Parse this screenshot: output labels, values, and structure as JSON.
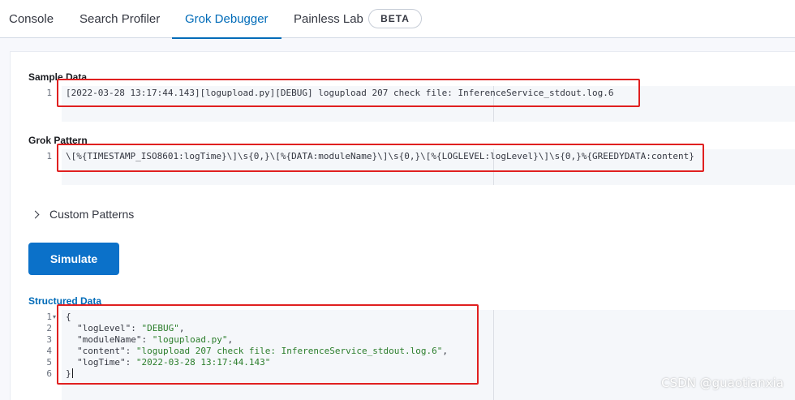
{
  "tabs": [
    {
      "label": "Console",
      "active": false
    },
    {
      "label": "Search Profiler",
      "active": false
    },
    {
      "label": "Grok Debugger",
      "active": true
    },
    {
      "label": "Painless Lab",
      "active": false
    }
  ],
  "badge": "BETA",
  "sample_data": {
    "label": "Sample Data",
    "lines": [
      {
        "num": "1",
        "text": "[2022-03-28 13:17:44.143][logupload.py][DEBUG] logupload 207 check file: InferenceService_stdout.log.6"
      }
    ]
  },
  "grok_pattern": {
    "label": "Grok Pattern",
    "lines": [
      {
        "num": "1",
        "text": "\\[%{TIMESTAMP_ISO8601:logTime}\\]\\s{0,}\\[%{DATA:moduleName}\\]\\s{0,}\\[%{LOGLEVEL:logLevel}\\]\\s{0,}%{GREEDYDATA:content}"
      }
    ]
  },
  "custom_patterns_label": "Custom Patterns",
  "simulate_label": "Simulate",
  "structured_data": {
    "label": "Structured Data",
    "line_numbers": [
      "1",
      "2",
      "3",
      "4",
      "5",
      "6"
    ],
    "open_brace": "{",
    "close_brace": "}",
    "fields": [
      {
        "key": "\"logLevel\"",
        "value": "\"DEBUG\"",
        "comma": ","
      },
      {
        "key": "\"moduleName\"",
        "value": "\"logupload.py\"",
        "comma": ","
      },
      {
        "key": "\"content\"",
        "value": "\"logupload 207 check file: InferenceService_stdout.log.6\"",
        "comma": ","
      },
      {
        "key": "\"logTime\"",
        "value": "\"2022-03-28 13:17:44.143\"",
        "comma": ""
      }
    ]
  },
  "watermark": "CSDN @guaotianxia",
  "colors": {
    "accent": "#006bb8",
    "button": "#0b71c9",
    "highlight": "#e02020",
    "string": "#2a7d2a"
  }
}
